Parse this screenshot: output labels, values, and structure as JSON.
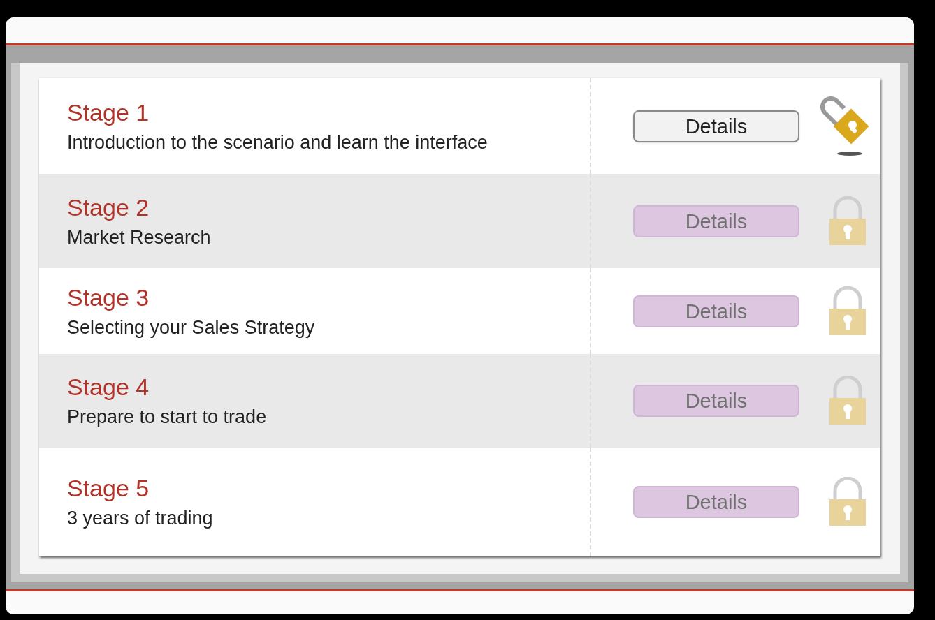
{
  "stages": [
    {
      "title": "Stage 1",
      "description": "Introduction to the scenario and learn the interface",
      "button": "Details",
      "locked": false
    },
    {
      "title": "Stage 2",
      "description": "Market Research",
      "button": "Details",
      "locked": true
    },
    {
      "title": "Stage 3",
      "description": "Selecting your Sales Strategy",
      "button": "Details",
      "locked": true
    },
    {
      "title": "Stage 4",
      "description": "Prepare to start to trade",
      "button": "Details",
      "locked": true
    },
    {
      "title": "Stage 5",
      "description": "3 years of trading",
      "button": "Details",
      "locked": true
    }
  ]
}
